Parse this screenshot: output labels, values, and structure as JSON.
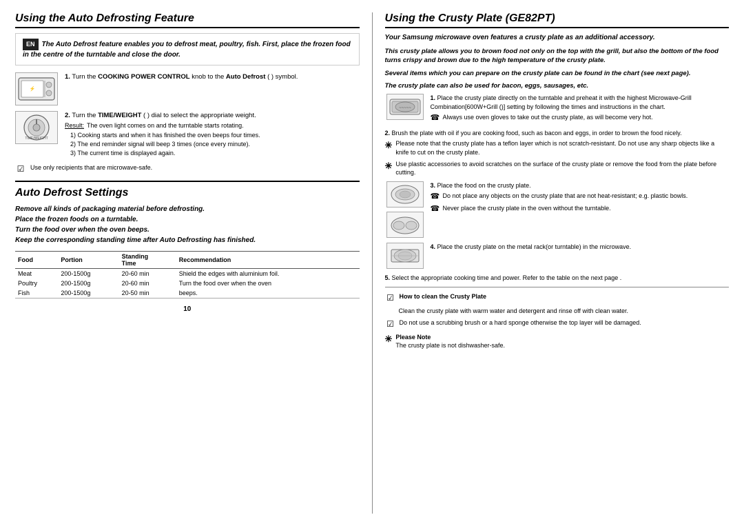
{
  "left": {
    "section1": {
      "title": "Using the Auto Defrosting Feature",
      "en_badge": "EN",
      "intro": "The Auto Defrost feature enables you to defrost meat, poultry, fish. First, place the frozen food in the centre of the turntable and close the door.",
      "steps": [
        {
          "id": 1,
          "text": "Turn the COOKING POWER CONTROL knob to the Auto Defrost ( ) symbol.",
          "text_bold": "COOKING POWER CONTROL",
          "text_bold2": "Auto Defrost"
        },
        {
          "id": 2,
          "text": "Turn the TIME/WEIGHT ( ) dial to select the appropriate weight.",
          "text_bold": "TIME/WEIGHT",
          "result_label": "Result:",
          "result_text": "The oven light comes on and the turntable starts rotating.",
          "sub_items": [
            "Cooking starts and when it has finished the oven beeps four times.",
            "The end reminder signal will beep 3 times (once every minute).",
            "The current time is displayed again."
          ]
        }
      ],
      "note": "Use only recipients that are microwave-safe."
    },
    "section2": {
      "title": "Auto Defrost Settings",
      "instructions": [
        "Remove all kinds of packaging material before defrosting.",
        "Place the frozen foods on a turntable.",
        "Turn the food over when the oven beeps.",
        "Keep the corresponding standing time after Auto Defrosting has finished."
      ],
      "table": {
        "headers": [
          "Food",
          "Portion",
          "Standing Time",
          "Recommendation"
        ],
        "rows": [
          [
            "Meat",
            "200-1500g",
            "20-60 min",
            "Shield the edges with aluminium foil."
          ],
          [
            "Poultry",
            "200-1500g",
            "20-60 min",
            "Turn the food over when the oven beeps."
          ],
          [
            "Fish",
            "200-1500g",
            "20-50 min",
            "beeps."
          ]
        ]
      }
    }
  },
  "right": {
    "section_title": "Using the Crusty Plate (GE82PT)",
    "intro": "Your Samsung microwave oven features a crusty plate as an additional accessory.",
    "para1": "This crusty plate allows you to brown food not only on the top with the grill, but also the bottom of the food turns crispy and brown due to the high temperature of the crusty plate.",
    "para2": "Several items which you can prepare on the crusty plate can be found in the chart (see next page).",
    "para3": "The crusty plate can also be used for bacon, eggs, sausages, etc.",
    "steps": [
      {
        "id": 1,
        "text": "Place the crusty plate directly on the turntable and preheat it with the highest Microwave-Grill Combination[600W+Grill ()] setting by following the times and instructions in the chart.",
        "sub_notes": [
          "Always use oven gloves to take out the crusty plate, as will become very hot."
        ]
      },
      {
        "id": 2,
        "text": "Brush the plate with oil if you are cooking food, such as bacon and eggs, in order to brown the food nicely.",
        "notes": [
          "Please note that the crusty plate has a teflon layer which is not scratch-resistant. Do not use any sharp objects like a knife to cut on the crusty plate.",
          "Use plastic accessories to avoid scratches on the surface of the crusty plate or remove the food from the plate before cutting."
        ]
      },
      {
        "id": 3,
        "text": "Place the food on the crusty plate.",
        "sub_notes": [
          "Do not place any objects on the crusty plate that are not heat-resistant; e.g. plastic bowls.",
          "Never place the crusty plate in the oven without the turntable."
        ]
      },
      {
        "id": 4,
        "text": "Place the crusty plate on the metal rack(or turntable) in the microwave."
      },
      {
        "id": 5,
        "text": "Select the appropriate cooking time and power. Refer to the table on the next page ."
      }
    ],
    "cleaning": {
      "title": "How to clean the Crusty Plate",
      "text": "Clean the crusty plate with warm water and detergent and rinse off with clean water.",
      "note2": "Do not use a scrubbing brush or a hard sponge otherwise the top layer will be damaged.",
      "please_note_title": "Please Note",
      "please_note_text": "The crusty plate is not dishwasher-safe."
    }
  },
  "page_number": "10"
}
